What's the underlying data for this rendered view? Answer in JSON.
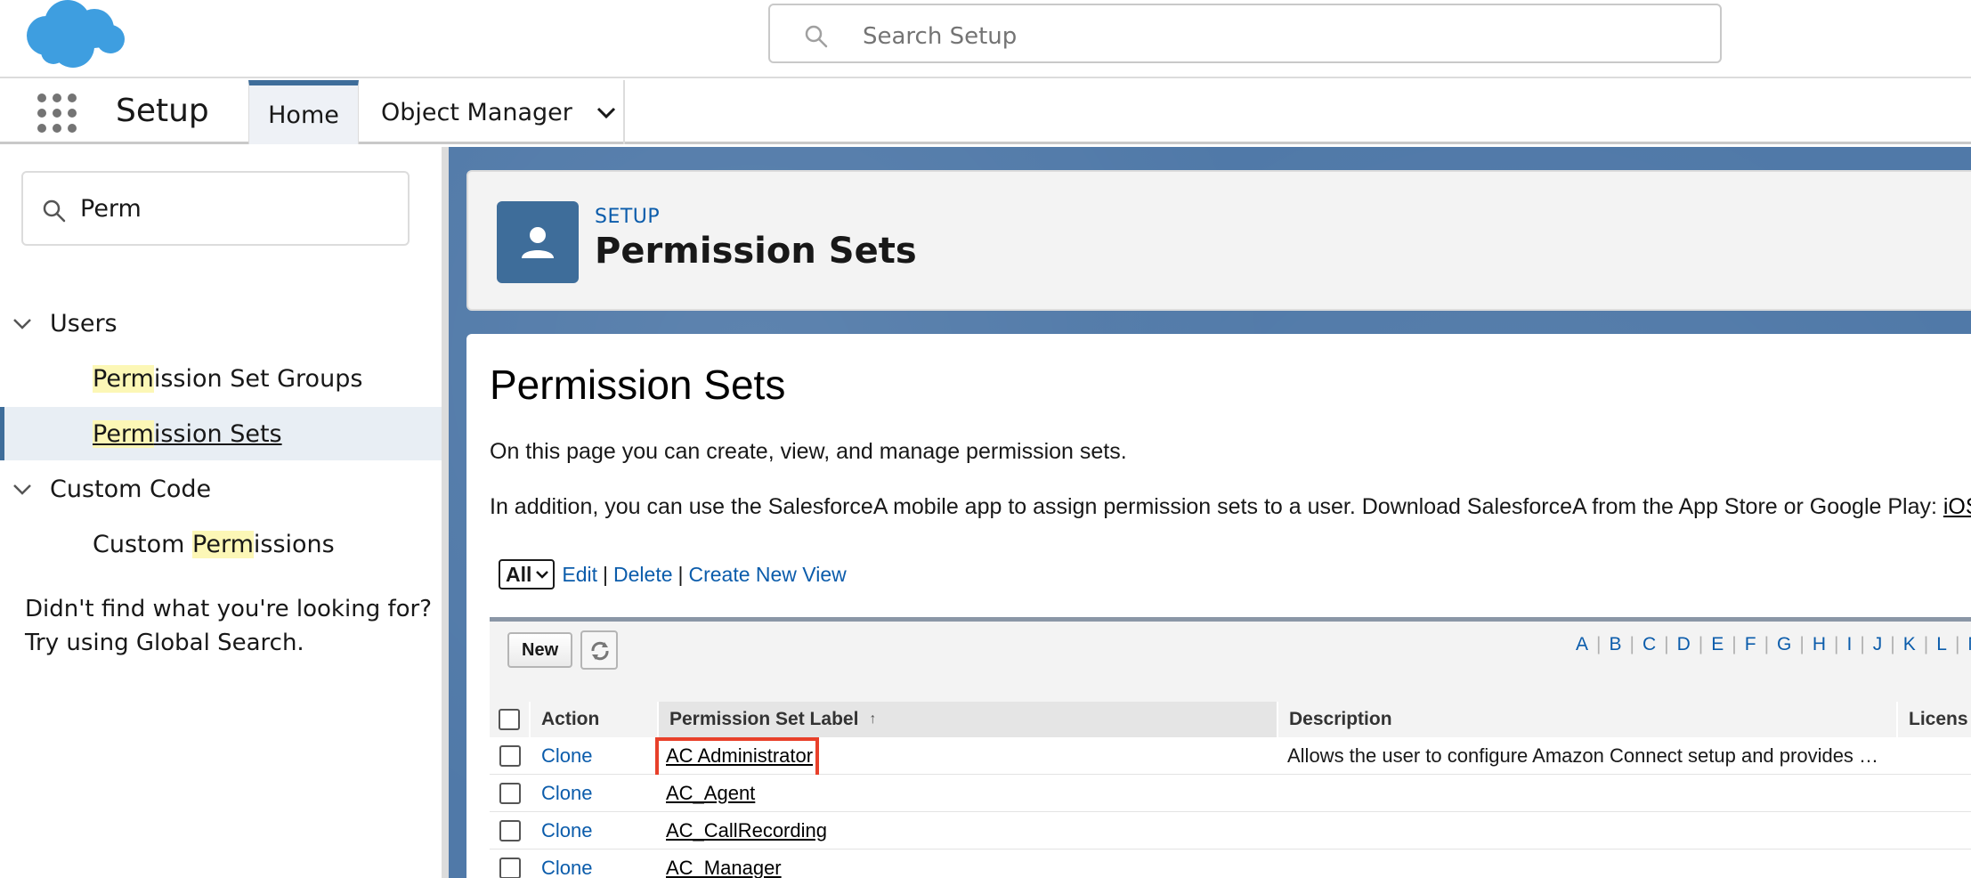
{
  "header": {
    "search_placeholder": "Search Setup"
  },
  "nav": {
    "app_name": "Setup",
    "tabs": [
      {
        "label": "Home",
        "active": true
      },
      {
        "label": "Object Manager",
        "active": false
      }
    ]
  },
  "sidebar": {
    "search_value": "Perm",
    "groups": [
      {
        "label": "Users",
        "items": [
          {
            "match": "Perm",
            "rest": "ission Set Groups"
          },
          {
            "match": "Perm",
            "rest": "ission Sets",
            "selected": true
          }
        ]
      },
      {
        "label": "Custom Code",
        "items": [
          {
            "prefix": "Custom ",
            "match": "Perm",
            "rest": "issions"
          }
        ]
      }
    ],
    "help_line1": "Didn't find what you're looking for?",
    "help_line2": "Try using Global Search."
  },
  "page_header": {
    "eyebrow": "SETUP",
    "title": "Permission Sets"
  },
  "content": {
    "title": "Permission Sets",
    "para1": "On this page you can create, view, and manage permission sets.",
    "para2": "In addition, you can use the SalesforceA mobile app to assign permission sets to a user. Download SalesforceA from the App Store or Google Play: ",
    "para2_link": "iOS",
    "view_select": "All",
    "view_links": [
      "Edit",
      "Delete",
      "Create New View"
    ]
  },
  "list": {
    "new_button": "New",
    "alphabet": [
      "A",
      "B",
      "C",
      "D",
      "E",
      "F",
      "G",
      "H",
      "I",
      "J",
      "K",
      "L",
      "M"
    ],
    "columns": {
      "action": "Action",
      "label": "Permission Set Label",
      "sort_arrow": "↑",
      "description": "Description",
      "license": "Licens"
    },
    "rows": [
      {
        "action": "Clone",
        "label": "AC Administrator",
        "description": "Allows the user to configure Amazon Connect setup and provides …"
      },
      {
        "action": "Clone",
        "label": "AC_Agent",
        "description": ""
      },
      {
        "action": "Clone",
        "label": "AC_CallRecording",
        "description": ""
      },
      {
        "action": "Clone",
        "label": "AC_Manager",
        "description": ""
      }
    ]
  },
  "colors": {
    "brand_cloud": "#3e9ee0",
    "accent": "#0b5cab",
    "page_icon": "#3e6d9a",
    "highlight_box": "#e8402a"
  }
}
